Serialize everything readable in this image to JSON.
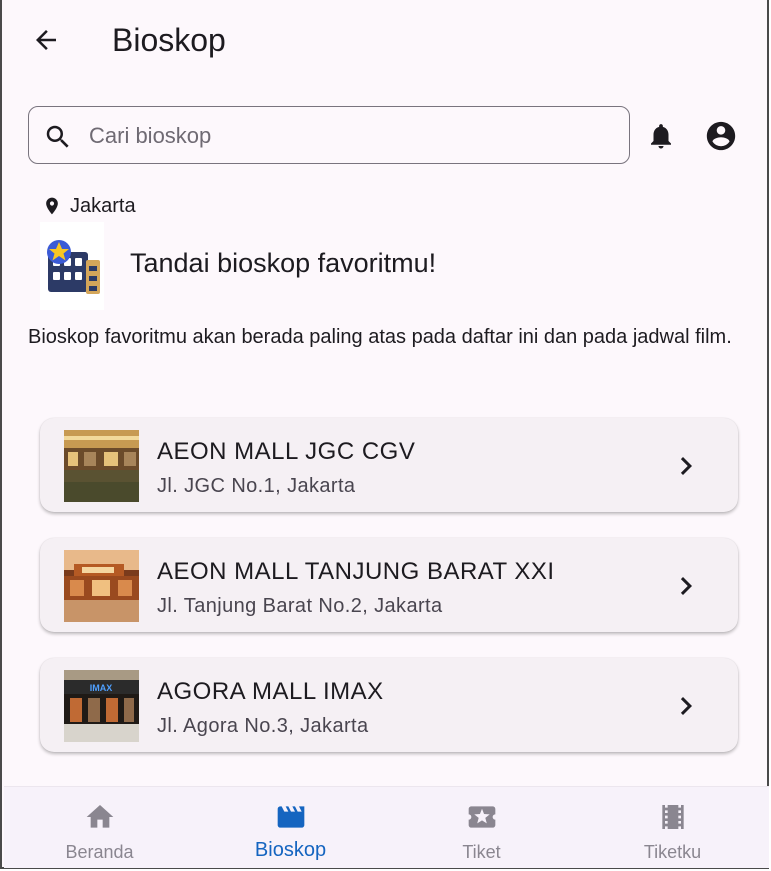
{
  "header": {
    "title": "Bioskop"
  },
  "search": {
    "placeholder": "Cari bioskop",
    "value": ""
  },
  "location": {
    "city": "Jakarta"
  },
  "favorite": {
    "title": "Tandai bioskop favoritmu!",
    "description": "Bioskop favoritmu akan berada paling atas pada daftar ini dan pada jadwal film."
  },
  "cinemas": [
    {
      "name": "AEON MALL JGC CGV",
      "address": "Jl. JGC No.1, Jakarta"
    },
    {
      "name": "AEON MALL TANJUNG BARAT XXI",
      "address": "Jl. Tanjung Barat No.2, Jakarta"
    },
    {
      "name": "AGORA MALL IMAX",
      "address": "Jl. Agora No.3, Jakarta"
    }
  ],
  "thumbnail_signs": {
    "imax": "IMAX"
  },
  "nav": {
    "items": [
      {
        "label": "Beranda",
        "icon": "home-icon"
      },
      {
        "label": "Bioskop",
        "icon": "movie-clapper-icon",
        "active": true
      },
      {
        "label": "Tiket",
        "icon": "ticket-icon"
      },
      {
        "label": "Tiketku",
        "icon": "film-strip-icon"
      }
    ]
  },
  "colors": {
    "accent": "#1565c0",
    "inactive": "#8a8690",
    "background": "#fdf8fc",
    "card": "#f5f0f4"
  }
}
